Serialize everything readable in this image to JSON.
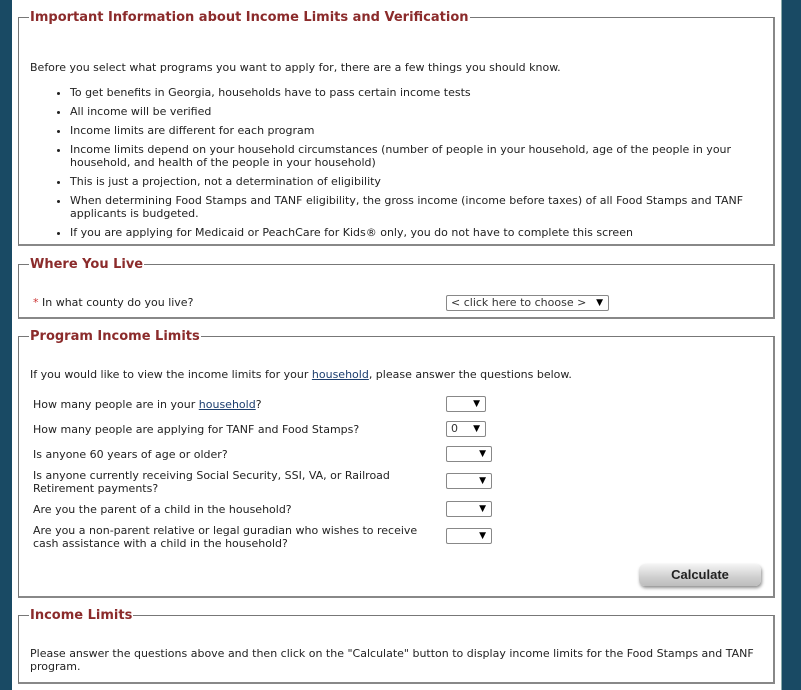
{
  "colors": {
    "frame": "#194a64",
    "legend": "#8b2b2b",
    "link": "#1b3d6e",
    "required_asterisk": "#cc3333"
  },
  "important_info": {
    "legend": "Important Information about Income Limits and Verification",
    "intro": "Before you select what programs you want to apply for, there are a few things you should know.",
    "bullets": [
      "To get benefits in Georgia, households have to pass certain income tests",
      "All income will be verified",
      "Income limits are different for each program",
      "Income limits depend on your household circumstances (number of people in your household, age of the people in your household, and health of the people in your household)",
      "This is just a projection, not a determination of eligibility",
      "When determining Food Stamps and TANF eligibility, the gross income (income before taxes) of all Food Stamps and TANF applicants is budgeted.",
      "If you are applying for Medicaid or PeachCare for Kids® only, you do not have to complete this screen"
    ]
  },
  "where_you_live": {
    "legend": "Where You Live",
    "required_marker": "*",
    "question": "In what county do you live?",
    "county_select_value": "< click here to choose >"
  },
  "program_income_limits": {
    "legend": "Program Income Limits",
    "intro_before": "If you would like to view the income limits for your ",
    "intro_link": "household",
    "intro_after": ", please answer the questions below.",
    "questions": [
      {
        "before": "How many people are in your ",
        "link": "household",
        "after": "?",
        "value": ""
      },
      {
        "before": "How many people are applying for TANF and Food Stamps?",
        "link": "",
        "after": "",
        "value": "0"
      },
      {
        "before": "Is anyone 60 years of age or older?",
        "link": "",
        "after": "",
        "value": ""
      },
      {
        "before": "Is anyone currently receiving Social Security, SSI, VA, or Railroad Retirement payments?",
        "link": "",
        "after": "",
        "value": ""
      },
      {
        "before": "Are you the parent of a child in the household?",
        "link": "",
        "after": "",
        "value": ""
      },
      {
        "before": "Are you a non-parent relative or legal guradian who wishes to receive cash assistance with a child in the household?",
        "link": "",
        "after": "",
        "value": ""
      }
    ],
    "calculate_label": "Calculate"
  },
  "income_limits": {
    "legend": "Income Limits",
    "message": "Please answer the questions above and then click on the \"Calculate\" button to display income limits for the Food Stamps and TANF program."
  },
  "icons": {
    "dropdown_arrow": "▼"
  }
}
